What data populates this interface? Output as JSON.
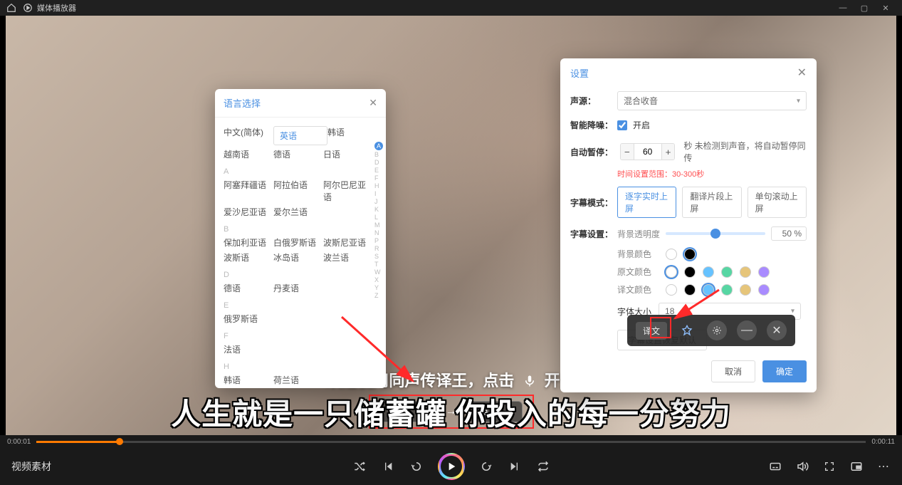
{
  "title_bar": {
    "app_title": "媒体播放器"
  },
  "video": {
    "hero_text_pre": "欢迎使用同声传译王，点击",
    "hero_text_post": "开始",
    "big_subtitle": "人生就是一只储蓄罐 你投入的每一分努力",
    "src_lang": "中文",
    "dst_lang": "英文"
  },
  "progress": {
    "current": "0:00:01",
    "total": "0:00:11"
  },
  "controls": {
    "video_title": "视频素材"
  },
  "lang_popup": {
    "title": "语言选择",
    "top_row1": [
      "中文(简体)",
      "英语",
      "韩语"
    ],
    "selected": "英语",
    "top_row2": [
      "越南语",
      "德语",
      "日语"
    ],
    "sections": [
      {
        "letter": "A",
        "rows": [
          [
            "阿塞拜疆语",
            "阿拉伯语",
            "阿尔巴尼亚语"
          ],
          [
            "爱沙尼亚语",
            "爱尔兰语",
            ""
          ]
        ]
      },
      {
        "letter": "B",
        "rows": [
          [
            "保加利亚语",
            "白俄罗斯语",
            "波斯尼亚语"
          ],
          [
            "波斯语",
            "冰岛语",
            "波兰语"
          ]
        ]
      },
      {
        "letter": "D",
        "rows": [
          [
            "德语",
            "丹麦语",
            ""
          ]
        ]
      },
      {
        "letter": "E",
        "rows": [
          [
            "俄罗斯语",
            "",
            ""
          ]
        ]
      },
      {
        "letter": "F",
        "rows": [
          [
            "法语",
            "",
            ""
          ]
        ]
      },
      {
        "letter": "H",
        "rows": [
          [
            "韩语",
            "荷兰语",
            ""
          ]
        ]
      }
    ],
    "alpha": [
      "A",
      "B",
      "D",
      "E",
      "F",
      "H",
      "I",
      "J",
      "K",
      "L",
      "M",
      "N",
      "P",
      "R",
      "S",
      "T",
      "W",
      "X",
      "Y",
      "Z"
    ]
  },
  "settings": {
    "title": "设置",
    "source_label": "声源",
    "source_value": "混合收音",
    "nr_label": "智能降噪",
    "nr_on_text": "开启",
    "nr_checked": true,
    "pause_label": "自动暂停",
    "pause_value": "60",
    "pause_suffix": "秒 未检测到声音，将自动暂停同传",
    "pause_tip": "时间设置范围：30-300秒",
    "mode_label": "字幕模式",
    "modes": [
      "逐字实时上屏",
      "翻译片段上屏",
      "单句滚动上屏"
    ],
    "mode_selected": 0,
    "subset_label": "字幕设置",
    "opacity_label": "背景透明度",
    "opacity_value": "50 %",
    "bg_color_label": "背景颜色",
    "src_color_label": "原文颜色",
    "dst_color_label": "译文颜色",
    "colors": [
      "#ffffff",
      "#000000",
      "#66c2ff",
      "#57d6a3",
      "#e6c57a",
      "#a98bff"
    ],
    "bg_sel": 1,
    "src_sel": 0,
    "dst_sel": 2,
    "fsize_label": "字体大小",
    "fsize_value": "18",
    "restore": "字幕设置恢复默认",
    "btn_cancel": "取消",
    "btn_ok": "确定"
  },
  "float_bar": {
    "translate_label": "译文"
  }
}
